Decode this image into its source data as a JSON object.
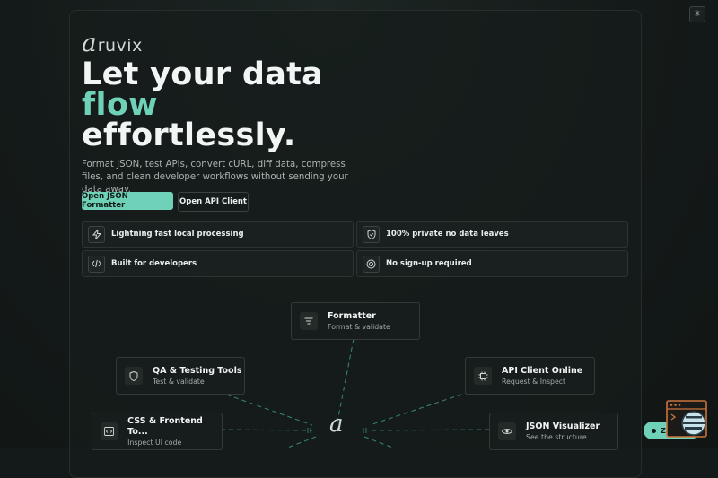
{
  "brand": {
    "name": "ruvix",
    "mark": "a"
  },
  "headline": {
    "line1": "Let your data",
    "line2": "flow",
    "line3": "effortlessly."
  },
  "subtitle": "Format JSON, test APIs, convert cURL, diff data, compress files, and clean developer workflows without sending your data away.",
  "actions": {
    "primary": "Open JSON Formatter",
    "secondary": "Open API Client"
  },
  "features": [
    {
      "label": "Lightning fast local processing",
      "icon": "lightning-icon"
    },
    {
      "label": "100% private no data leaves",
      "icon": "shield-icon"
    },
    {
      "label": "Built for developers",
      "icon": "code-icon"
    },
    {
      "label": "No sign-up required",
      "icon": "target-icon"
    }
  ],
  "nodes": [
    {
      "title": "Formatter",
      "subtitle": "Format & validate",
      "icon": "filter-icon"
    },
    {
      "title": "QA & Testing Tools",
      "subtitle": "Test & validate",
      "icon": "shield-icon"
    },
    {
      "title": "API Client Online",
      "subtitle": "Request & Inspect",
      "icon": "chip-icon"
    },
    {
      "title": "CSS & Frontend To...",
      "subtitle": "Inspect UI code",
      "icon": "code-icon"
    },
    {
      "title": "JSON Visualizer",
      "subtitle": "See the structure",
      "icon": "eye-icon"
    }
  ],
  "hub_mark": "a",
  "chat": {
    "label": "Zaki"
  },
  "colors": {
    "accent": "#6fd2b8",
    "background": "#141a19",
    "card_border": "#2c3432"
  }
}
